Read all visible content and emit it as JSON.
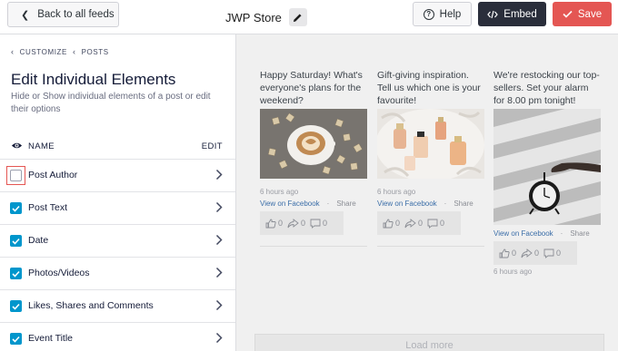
{
  "topbar": {
    "back_label": "Back to all feeds",
    "store_name": "JWP Store",
    "help_label": "Help",
    "embed_label": "Embed",
    "save_label": "Save"
  },
  "sidebar": {
    "breadcrumb": [
      "CUSTOMIZE",
      "POSTS"
    ],
    "title": "Edit Individual Elements",
    "description": "Hide or Show individual elements of a post or edit their options",
    "header_name": "NAME",
    "header_edit": "EDIT",
    "elements": [
      {
        "label": "Post Author",
        "checked": false
      },
      {
        "label": "Post Text",
        "checked": true
      },
      {
        "label": "Date",
        "checked": true
      },
      {
        "label": "Photos/Videos",
        "checked": true
      },
      {
        "label": "Likes, Shares and Comments",
        "checked": true
      },
      {
        "label": "Event Title",
        "checked": true
      }
    ]
  },
  "preview": {
    "posts": [
      {
        "caption": "Happy Saturday! What's everyone's plans for the weekend?",
        "time": "6 hours ago",
        "view_link": "View on Facebook",
        "share": "Share",
        "likes": "0",
        "shares": "0",
        "comments": "0"
      },
      {
        "caption": "Gift-giving inspiration. Tell us which one is your favourite!",
        "time": "6 hours ago",
        "view_link": "View on Facebook",
        "share": "Share",
        "likes": "0",
        "shares": "0",
        "comments": "0"
      },
      {
        "caption": "We're restocking our top-sellers. Set your alarm for 8.00 pm tonight!",
        "time": "6 hours ago",
        "view_link": "View on Facebook",
        "share": "Share",
        "likes": "0",
        "shares": "0",
        "comments": "0"
      }
    ],
    "load_more": "Load more"
  },
  "colors": {
    "accent_blue": "#0096cc",
    "embed_dark": "#2a2e3b",
    "save_red": "#e45653"
  }
}
